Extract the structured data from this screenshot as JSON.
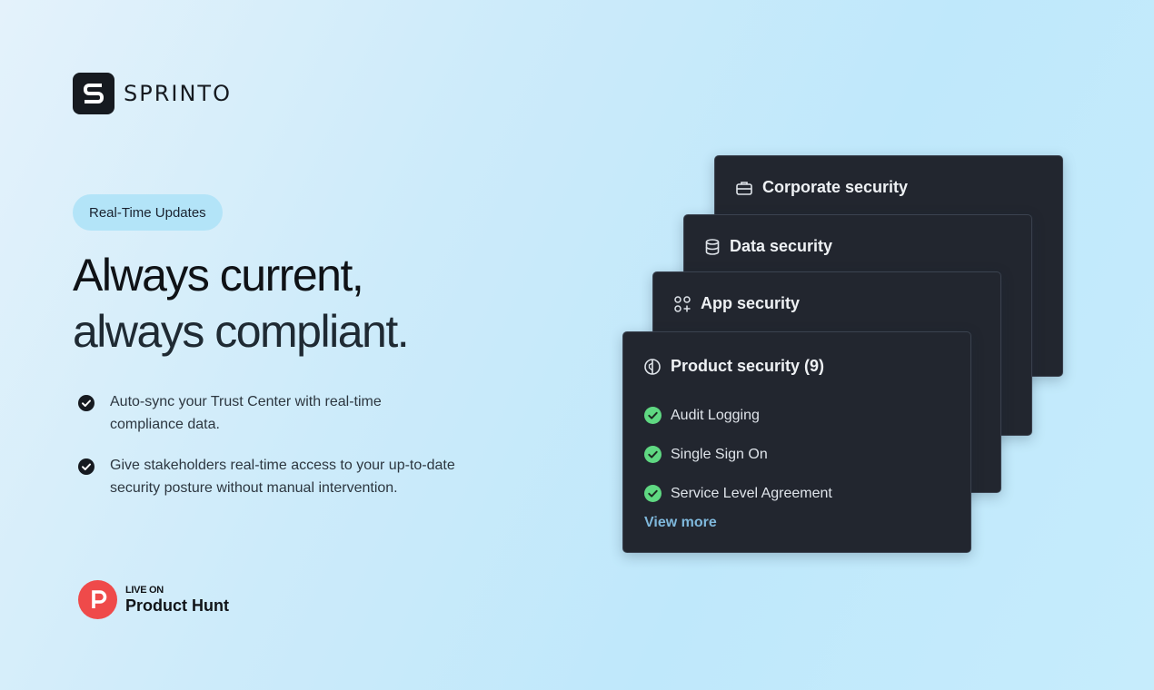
{
  "brand": {
    "name": "SPRINTO",
    "icon": "sprinto-logo-icon"
  },
  "hero": {
    "badge": "Real-Time Updates",
    "headline_line1": "Always current,",
    "headline_line2": "always compliant.",
    "bullets": [
      {
        "icon": "check-circle-icon",
        "text_line1": "Auto-sync your Trust Center with real-time",
        "text_line2": "compliance data."
      },
      {
        "icon": "check-circle-icon",
        "text_line1": "Give stakeholders real-time access to your up-to-date",
        "text_line2": "security posture without manual intervention."
      }
    ]
  },
  "product_hunt": {
    "small": "LIVE ON",
    "big": "Product Hunt",
    "icon": "product-hunt-icon"
  },
  "cards": [
    {
      "title": "Corporate security",
      "icon": "briefcase-icon"
    },
    {
      "title": "Data security",
      "icon": "database-icon"
    },
    {
      "title": "App security",
      "icon": "apps-grid-icon"
    },
    {
      "title": "Product security (9)",
      "icon": "shield-icon",
      "items": [
        {
          "label": "Audit Logging",
          "icon": "green-check-icon"
        },
        {
          "label": "Single Sign On",
          "icon": "green-check-icon"
        },
        {
          "label": "Service Level Agreement",
          "icon": "green-check-icon"
        }
      ],
      "link": "View more"
    }
  ],
  "colors": {
    "card_bg": "#22262f",
    "check_green": "#5fd882",
    "link_blue": "#7fb8dc",
    "product_hunt_red": "#ef4a4a",
    "pill_bg": "#b3e4f8"
  }
}
